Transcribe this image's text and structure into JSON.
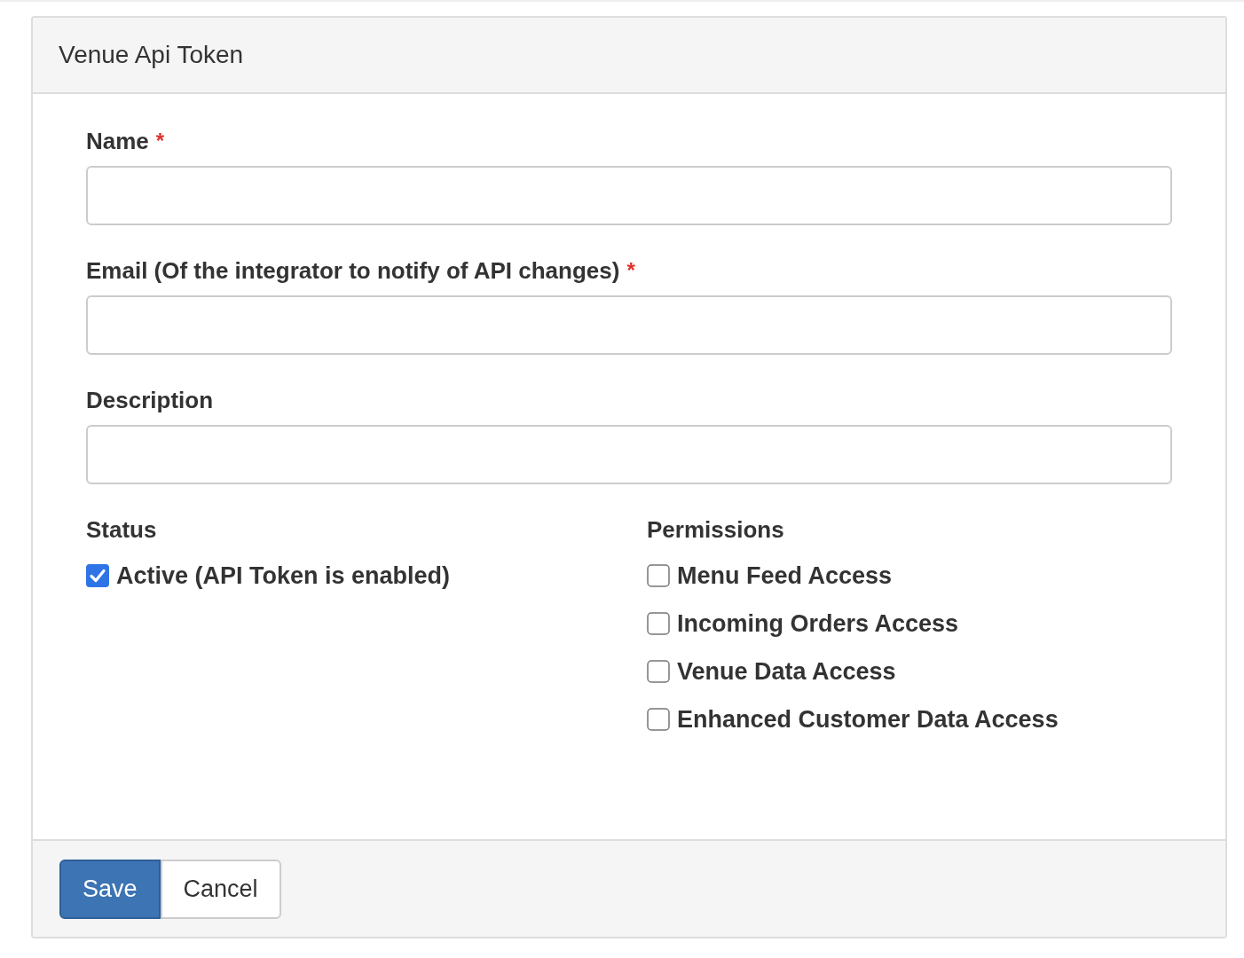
{
  "panel": {
    "title": "Venue Api Token"
  },
  "fields": [
    {
      "label": "Name",
      "required_mark": "*"
    },
    {
      "label": "Email (Of the integrator to notify of API changes)",
      "required_mark": "*"
    },
    {
      "label": "Description"
    }
  ],
  "status": {
    "heading": "Status",
    "options": [
      {
        "label": "Active (API Token is enabled)",
        "checked": true
      }
    ]
  },
  "permissions": {
    "heading": "Permissions",
    "options": [
      {
        "label": "Menu Feed Access",
        "checked": false
      },
      {
        "label": "Incoming Orders Access",
        "checked": false
      },
      {
        "label": "Venue Data Access",
        "checked": false
      },
      {
        "label": "Enhanced Customer Data Access",
        "checked": false
      }
    ]
  },
  "buttons": [
    {
      "label": "Save",
      "kind": "primary"
    },
    {
      "label": "Cancel",
      "kind": "default"
    }
  ]
}
